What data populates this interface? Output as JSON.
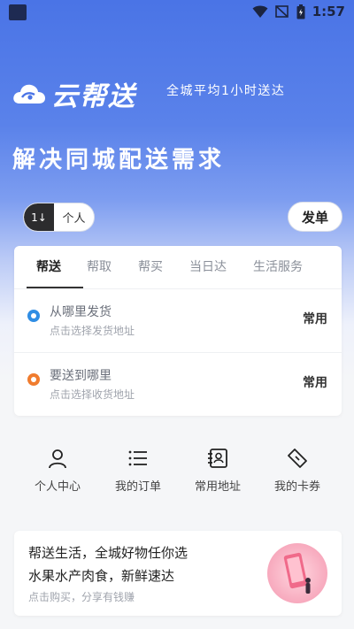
{
  "status_bar": {
    "time": "1:57"
  },
  "brand": {
    "name": "云帮送",
    "slogan": "全城平均1小时送达"
  },
  "headline": "解决同城配送需求",
  "toggle": {
    "left_label": "1↓",
    "right_label": "个人"
  },
  "send_button": "发单",
  "tabs": [
    {
      "label": "帮送",
      "active": true
    },
    {
      "label": "帮取",
      "active": false
    },
    {
      "label": "帮买",
      "active": false
    },
    {
      "label": "当日达",
      "active": false
    },
    {
      "label": "生活服务",
      "active": false
    }
  ],
  "pickup": {
    "title": "从哪里发货",
    "subtitle": "点击选择发货地址",
    "common_label": "常用",
    "dot_color": "#2f8de4"
  },
  "dropoff": {
    "title": "要送到哪里",
    "subtitle": "点击选择收货地址",
    "common_label": "常用",
    "dot_color": "#f07c2e"
  },
  "quick_actions": [
    {
      "label": "个人中心",
      "icon": "person-icon"
    },
    {
      "label": "我的订单",
      "icon": "list-icon"
    },
    {
      "label": "常用地址",
      "icon": "address-book-icon"
    },
    {
      "label": "我的卡券",
      "icon": "ticket-icon"
    }
  ],
  "promo": {
    "line1": "帮送生活，全城好物任你选",
    "line2": "水果水产肉食，新鲜速达",
    "subtitle": "点击购买，分享有钱赚"
  },
  "colors": {
    "primary": "#4a74e6",
    "pickup_dot": "#2f8de4",
    "dropoff_dot": "#f07c2e"
  }
}
